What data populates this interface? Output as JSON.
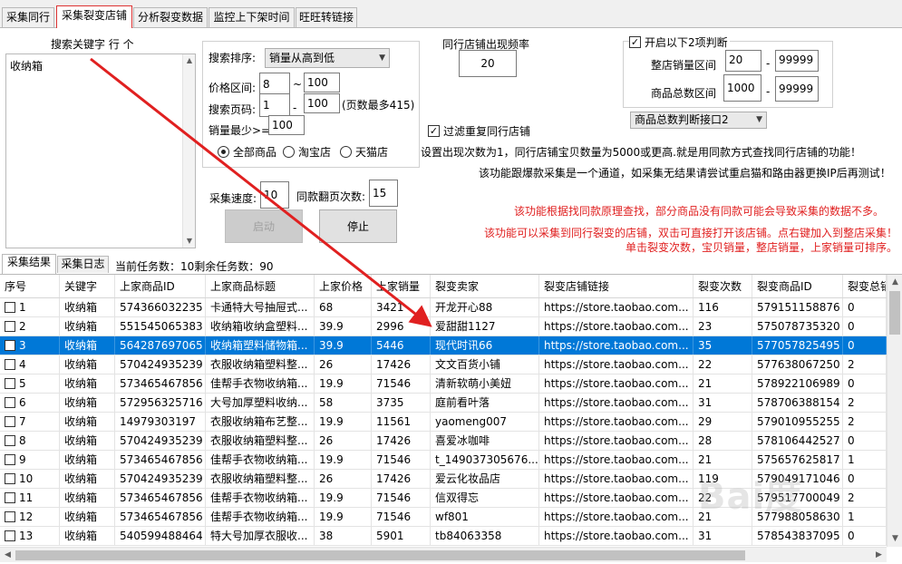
{
  "tabs": [
    {
      "label": "采集同行",
      "active": false
    },
    {
      "label": "采集裂变店铺",
      "active": true
    },
    {
      "label": "分析裂变数据",
      "active": false
    },
    {
      "label": "监控上下架时间",
      "active": false
    },
    {
      "label": "旺旺转链接",
      "active": false
    }
  ],
  "keywords": {
    "label": "搜索关键字    行  个",
    "value": "收纳箱"
  },
  "search": {
    "sort_label": "搜索排序:",
    "sort_value": "销量从高到低",
    "price_label": "价格区间:",
    "price_min": "8",
    "price_tilde": "~",
    "price_max": "100",
    "page_label": "搜索页码:",
    "page_min": "1",
    "page_dash": "-",
    "page_max": "100",
    "page_note": "(页数最多415)",
    "min_sales_label": "销量最少>=",
    "min_sales_value": "100",
    "radio_all": "全部商品",
    "radio_taobao": "淘宝店",
    "radio_tmall": "天猫店"
  },
  "freq": {
    "label": "同行店铺出现频率",
    "value": "20"
  },
  "filter_dup": {
    "label": "过滤重复同行店铺",
    "check_mark": "✓"
  },
  "judge": {
    "enable_label": "开启以下2项判断",
    "check_mark": "✓",
    "shop_sales_label": "整店销量区间",
    "shop_sales_min": "20",
    "shop_sales_dash": "-",
    "shop_sales_max": "99999",
    "total_sales_label": "商品总数区间",
    "total_sales_min": "1000",
    "total_sales_dash": "-",
    "total_sales_max": "99999",
    "interface_value": "商品总数判断接口2"
  },
  "messages": {
    "line1": "设置出现次数为1，同行店铺宝贝数量为5000或更高.就是用同款方式查找同行店铺的功能！",
    "line2": "该功能跟爆款采集是一个通道，如采集无结果请尝试重启猫和路由器更换IP后再测试！",
    "line3": "该功能根据找同款原理查找，部分商品没有同款可能会导致采集的数据不多。",
    "line4": "该功能可以采集到同行裂变的店铺，双击可直接打开该店铺。点右键加入到整店采集！",
    "line5": "单击裂变次数，宝贝销量，整店销量，上家销量可排序。"
  },
  "speed": {
    "label": "采集速度:",
    "value": "10",
    "pages_label": "同款翻页次数:",
    "pages_value": "15"
  },
  "buttons": {
    "start": "启动",
    "stop": "停止"
  },
  "subtabs": [
    {
      "label": "采集结果",
      "active": true
    },
    {
      "label": "采集日志",
      "active": false
    }
  ],
  "status": "当前任务数：10剩余任务数：90",
  "columns": [
    "序号",
    "关键字",
    "上家商品ID",
    "上家商品标题",
    "上家价格",
    "上家销量",
    "裂变卖家",
    "裂变店铺链接",
    "裂变次数",
    "裂变商品ID",
    "裂变总销"
  ],
  "rows": [
    [
      "1",
      "收纳箱",
      "574366032235",
      "卡通特大号抽屉式...",
      "68",
      "3421",
      "开龙开心88",
      "https://store.taobao.com...",
      "116",
      "579151158876",
      "0"
    ],
    [
      "2",
      "收纳箱",
      "551545065383",
      "收纳箱收纳盒塑料...",
      "39.9",
      "2996",
      "爱甜甜1127",
      "https://store.taobao.com...",
      "23",
      "575078735320",
      "0"
    ],
    [
      "3",
      "收纳箱",
      "564287697065",
      "收纳箱塑料储物箱...",
      "39.9",
      "5446",
      "现代时讯66",
      "https://store.taobao.com...",
      "35",
      "577057825495",
      "0"
    ],
    [
      "4",
      "收纳箱",
      "570424935239",
      "衣服收纳箱塑料整...",
      "26",
      "17426",
      "文文百货小铺",
      "https://store.taobao.com...",
      "22",
      "577638067250",
      "2"
    ],
    [
      "5",
      "收纳箱",
      "573465467856",
      "佳帮手衣物收纳箱...",
      "19.9",
      "71546",
      "清新软萌小美妞",
      "https://store.taobao.com...",
      "21",
      "578922106989",
      "0"
    ],
    [
      "6",
      "收纳箱",
      "572956325716",
      "大号加厚塑料收纳...",
      "58",
      "3735",
      "庭前看叶落",
      "https://store.taobao.com...",
      "31",
      "578706388154",
      "2"
    ],
    [
      "7",
      "收纳箱",
      "14979303197",
      "衣服收纳箱布艺整...",
      "19.9",
      "11561",
      "yaomeng007",
      "https://store.taobao.com...",
      "29",
      "579010955255",
      "2"
    ],
    [
      "8",
      "收纳箱",
      "570424935239",
      "衣服收纳箱塑料整...",
      "26",
      "17426",
      "喜爱冰咖啡",
      "https://store.taobao.com...",
      "28",
      "578106442527",
      "0"
    ],
    [
      "9",
      "收纳箱",
      "573465467856",
      "佳帮手衣物收纳箱...",
      "19.9",
      "71546",
      "t_149037305676...",
      "https://store.taobao.com...",
      "21",
      "575657625817",
      "1"
    ],
    [
      "10",
      "收纳箱",
      "570424935239",
      "衣服收纳箱塑料整...",
      "26",
      "17426",
      "爱云化妆品店",
      "https://store.taobao.com...",
      "119",
      "579049171046",
      "0"
    ],
    [
      "11",
      "收纳箱",
      "573465467856",
      "佳帮手衣物收纳箱...",
      "19.9",
      "71546",
      "信双得忘",
      "https://store.taobao.com...",
      "22",
      "579517700049",
      "2"
    ],
    [
      "12",
      "收纳箱",
      "573465467856",
      "佳帮手衣物收纳箱...",
      "19.9",
      "71546",
      "wf801",
      "https://store.taobao.com...",
      "21",
      "577988058630",
      "1"
    ],
    [
      "13",
      "收纳箱",
      "540599488464",
      "特大号加厚衣服收...",
      "38",
      "5901",
      "tb84063358",
      "https://store.taobao.com...",
      "31",
      "578543837095",
      "0"
    ]
  ],
  "selected_row": 3,
  "watermark": "Bai度",
  "colors": {
    "selection": "#0078d7",
    "arrow": "#e02020",
    "highlight_box": "#dd3333"
  }
}
